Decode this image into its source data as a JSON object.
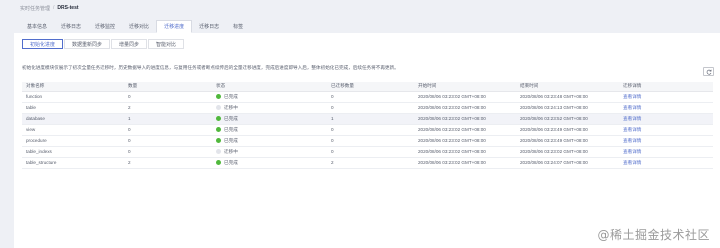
{
  "breadcrumb": {
    "parent": "实时任务管理",
    "separator": "/",
    "current": "DRS-test"
  },
  "top_tabs": [
    "基本信息",
    "迁移日志",
    "迁移监控",
    "迁移对比",
    "迁移进度",
    "迁移日志",
    "标签"
  ],
  "active_top_tab": 4,
  "sub_tabs": [
    "初始化进度",
    "数据重新同步",
    "增量同步",
    "智能对比"
  ],
  "active_sub_tab": 0,
  "description": "初始化进度模块仅展示了初次全量任务迁移时，历史数据导入的进度信息，与复用任务或者断点续传后的全量迁移进度，完成后进度即导入后，整体初始化已完成，后续任务将不再更新。",
  "table": {
    "headers": [
      "对象名称",
      "数量",
      "状态",
      "已迁移数量",
      "开始时间",
      "结束时间",
      "迁移详情"
    ],
    "rows": [
      {
        "name": "function",
        "count": "0",
        "status": "已完成",
        "state": "done",
        "done": "0",
        "start": "2020/08/06 03:23:02 GMT+08:00",
        "end": "2020/08/06 03:23:48 GMT+08:00",
        "detail": "查看详情"
      },
      {
        "name": "table",
        "count": "2",
        "status": "迁移中",
        "state": "run",
        "done": "0",
        "start": "2020/08/06 03:23:02 GMT+08:00",
        "end": "2020/08/06 03:24:13 GMT+08:00",
        "detail": "查看详情"
      },
      {
        "name": "database",
        "count": "1",
        "status": "已完成",
        "state": "done",
        "done": "1",
        "start": "2020/08/06 03:23:02 GMT+08:00",
        "end": "2020/08/06 03:23:52 GMT+08:00",
        "detail": "查看详情"
      },
      {
        "name": "view",
        "count": "0",
        "status": "已完成",
        "state": "done",
        "done": "0",
        "start": "2020/08/06 03:23:02 GMT+08:00",
        "end": "2020/08/06 03:23:49 GMT+08:00",
        "detail": "查看详情"
      },
      {
        "name": "procedure",
        "count": "0",
        "status": "已完成",
        "state": "done",
        "done": "0",
        "start": "2020/08/06 03:23:02 GMT+08:00",
        "end": "2020/08/06 03:23:49 GMT+08:00",
        "detail": "查看详情"
      },
      {
        "name": "table_indexs",
        "count": "0",
        "status": "迁移中",
        "state": "run",
        "done": "0",
        "start": "2020/08/06 03:23:02 GMT+08:00",
        "end": "2020/08/06 03:23:02 GMT+08:00",
        "detail": "查看详情"
      },
      {
        "name": "table_structure",
        "count": "2",
        "status": "已完成",
        "state": "done",
        "done": "2",
        "start": "2020/08/06 03:23:02 GMT+08:00",
        "end": "2020/08/06 03:24:07 GMT+08:00",
        "detail": "查看详情"
      }
    ]
  },
  "highlighted_row": 2,
  "icons": {
    "refresh": "refresh-icon"
  },
  "colors": {
    "accent": "#526ecc",
    "done": "#50b83c",
    "running": "#e2e4ea"
  },
  "watermark": "@稀土掘金技术社区"
}
